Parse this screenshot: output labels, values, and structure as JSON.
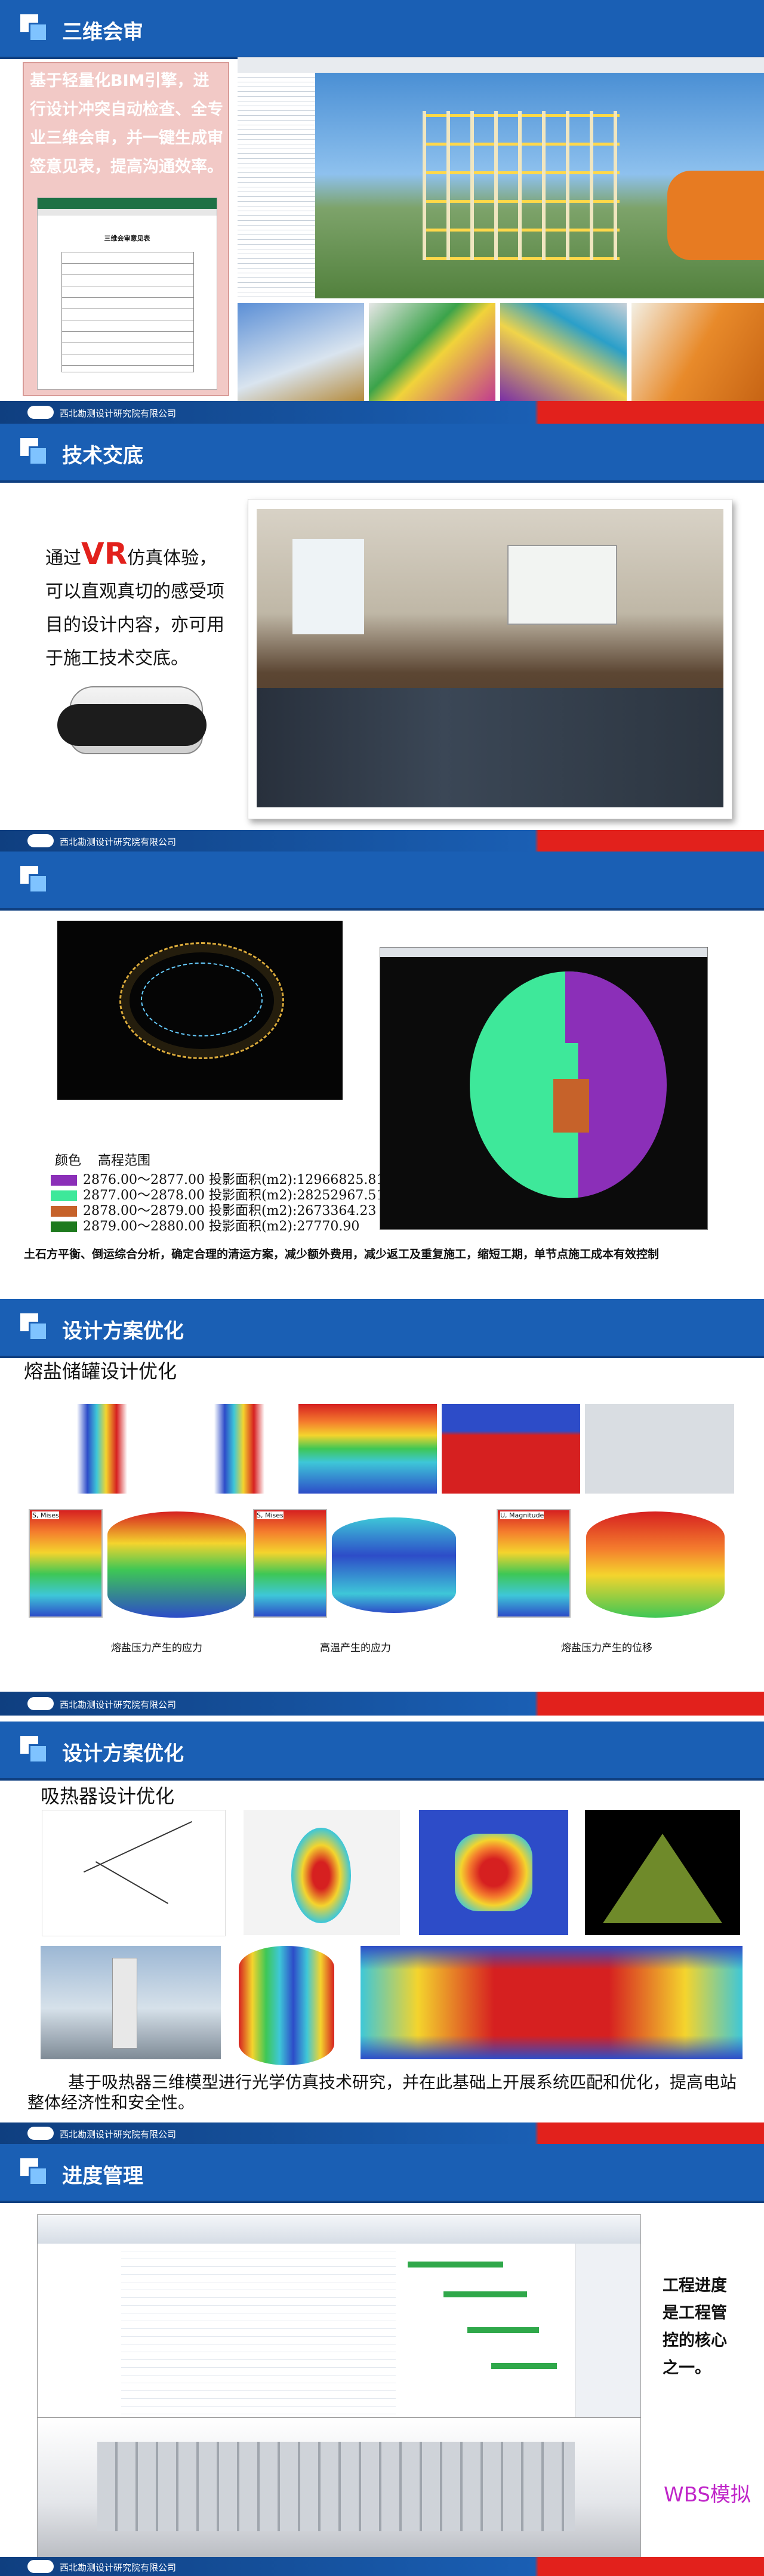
{
  "company": "西北勘测设计研究院有限公司",
  "section1": {
    "title": "三维会审",
    "desc": "基于轻量化BIM引擎，进行设计冲突自动检查、全专业三维会审，并一键生成审签意见表，提高沟通效率。",
    "doc_title": "三维会审意见表"
  },
  "section2": {
    "title": "技术交底",
    "vr_prefix": "通过",
    "vr_highlight": "VR",
    "vr_suffix": "仿真体验，",
    "desc": "可以直观真切的感受项目的设计内容，亦可用于施工技术交底。"
  },
  "section3": {
    "title": "",
    "legend_header": [
      "颜色",
      "高程范围"
    ],
    "legend": [
      {
        "color": "#8b2fb8",
        "text": "2876.00～2877.00 投影面积(m2):12966825.81"
      },
      {
        "color": "#3ee89a",
        "text": "2877.00～2878.00 投影面积(m2):28252967.51"
      },
      {
        "color": "#c6622a",
        "text": "2878.00～2879.00 投影面积(m2):2673364.23"
      },
      {
        "color": "#1e7a1e",
        "text": "2879.00～2880.00 投影面积(m2):27770.90"
      }
    ],
    "caption": "土石方平衡、倒运综合分析，确定合理的清运方案，减少额外费用，减少返工及重复施工，缩短工期，单节点施工成本有效控制"
  },
  "section4": {
    "title": "设计方案优化",
    "subtitle": "熔盐储罐设计优化",
    "labels": [
      "熔盐压力产生的应力",
      "高温产生的应力",
      "熔盐压力产生的位移"
    ],
    "legend_titles": [
      "S, Mises",
      "S, Mises",
      "U, Magnitude"
    ]
  },
  "section5": {
    "title": "设计方案优化",
    "subtitle": "吸热器设计优化",
    "caption": "基于吸热器三维模型进行光学仿真技术研究，并在此基础上开展系统匹配和优化，提高电站整体经济性和安全性。"
  },
  "section6": {
    "title": "进度管理",
    "side_text": "工程进度是工程管控的核心之一。",
    "wbs_text": "WBS模拟"
  },
  "colors": {
    "header_blue": "#1a5fb4",
    "accent_red": "#e2211c",
    "vr_red": "#e2211c",
    "wbs_magenta": "#c026c9"
  }
}
